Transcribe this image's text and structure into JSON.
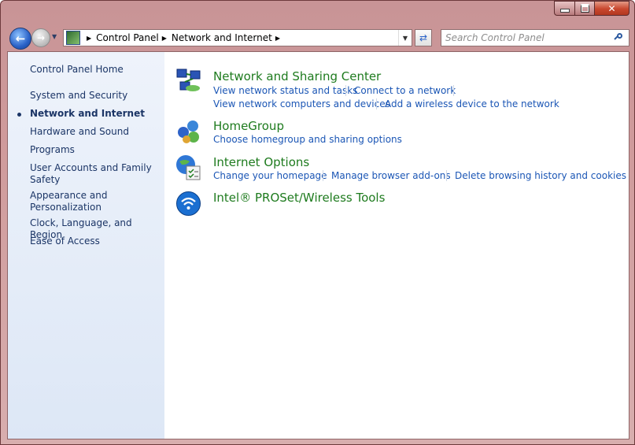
{
  "window": {
    "caption_buttons": {
      "minimize": "",
      "maximize": "",
      "close": "✕"
    }
  },
  "navbar": {
    "breadcrumbs": [
      "Control Panel",
      "Network and Internet"
    ],
    "search_placeholder": "Search Control Panel"
  },
  "sidebar": {
    "home": "Control Panel Home",
    "items": [
      "System and Security",
      "Network and Internet",
      "Hardware and Sound",
      "Programs",
      "User Accounts and Family Safety",
      "Appearance and Personalization",
      "Clock, Language, and Region",
      "Ease of Access"
    ],
    "active_item": "Network and Internet"
  },
  "categories": [
    {
      "title": "Network and Sharing Center",
      "icon": "network-center-icon",
      "tasks": [
        "View network status and tasks",
        "Connect to a network",
        "View network computers and devices",
        "Add a wireless device to the network"
      ]
    },
    {
      "title": "HomeGroup",
      "icon": "homegroup-icon",
      "tasks": [
        "Choose homegroup and sharing options"
      ]
    },
    {
      "title": "Internet Options",
      "icon": "internet-options-icon",
      "tasks": [
        "Change your homepage",
        "Manage browser add-ons",
        "Delete browsing history and cookies"
      ]
    },
    {
      "title": "Intel® PROSet/Wireless Tools",
      "icon": "intel-wireless-icon",
      "tasks": []
    }
  ],
  "colors": {
    "link": "#1b56b5",
    "category_title": "#1e7b1e",
    "sidebar_text": "#1b3566"
  }
}
